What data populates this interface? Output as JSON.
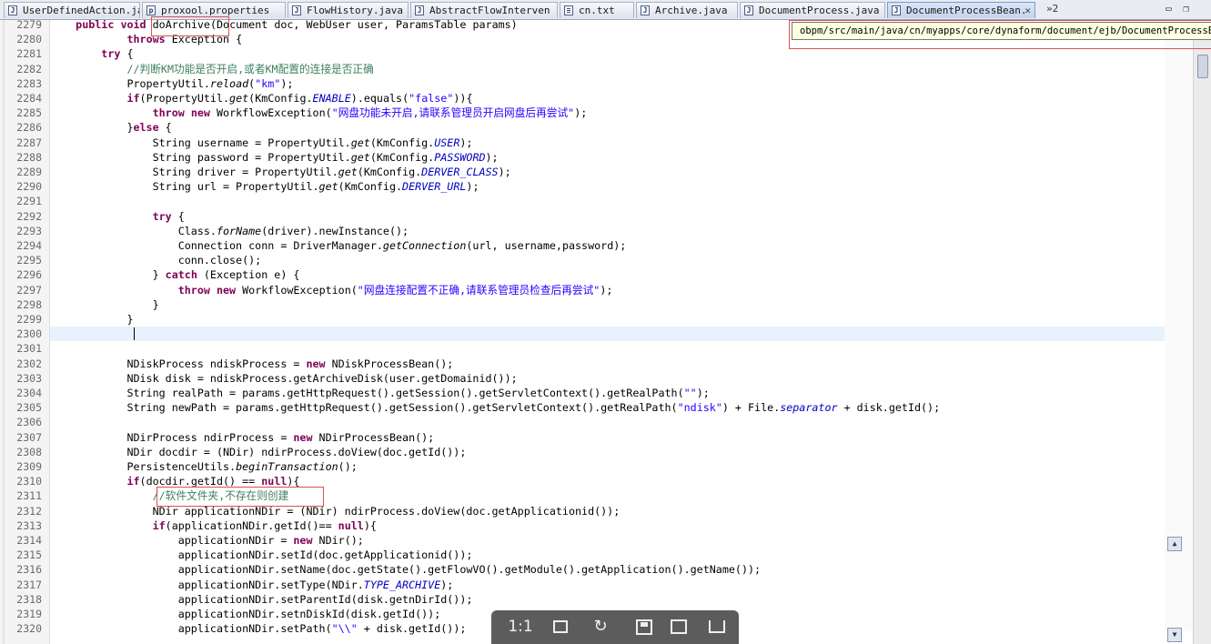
{
  "tabs": [
    {
      "label": "UserDefinedAction.ja",
      "active": false
    },
    {
      "label": "proxool.properties",
      "active": false
    },
    {
      "label": "FlowHistory.java",
      "active": false
    },
    {
      "label": "AbstractFlowInterven",
      "active": false
    },
    {
      "label": "cn.txt",
      "active": false
    },
    {
      "label": "Archive.java",
      "active": false
    },
    {
      "label": "DocumentProcess.java",
      "active": false
    },
    {
      "label": "DocumentProcessBean.",
      "active": true,
      "close": "✕"
    }
  ],
  "tab_overflow": "»2",
  "tooltip_path": "obpm/src/main/java/cn/myapps/core/dynaform/document/ejb/DocumentProcessBean.java",
  "line_numbers": [
    "2279",
    "2280",
    "2281",
    "2282",
    "2283",
    "2284",
    "2285",
    "2286",
    "2287",
    "2288",
    "2289",
    "2290",
    "2291",
    "2292",
    "2293",
    "2294",
    "2295",
    "2296",
    "2297",
    "2298",
    "2299",
    "2300",
    "2301",
    "2302",
    "2303",
    "2304",
    "2305",
    "2306",
    "2307",
    "2308",
    "2309",
    "2310",
    "2311",
    "2312",
    "2313",
    "2314",
    "2315",
    "2316",
    "2317",
    "2318",
    "2319",
    "2320"
  ],
  "code_lines": [
    "    public void doArchive(Document doc, WebUser user, ParamsTable params)",
    "            throws Exception {",
    "        try {",
    "            //判断KM功能是否开启,或者KM配置的连接是否正确",
    "            PropertyUtil.reload(\"km\");",
    "            if(PropertyUtil.get(KmConfig.ENABLE).equals(\"false\")){",
    "                throw new WorkflowException(\"网盘功能未开启,请联系管理员开启网盘后再尝试\");",
    "            }else {",
    "                String username = PropertyUtil.get(KmConfig.USER);",
    "                String password = PropertyUtil.get(KmConfig.PASSWORD);",
    "                String driver = PropertyUtil.get(KmConfig.DERVER_CLASS);",
    "                String url = PropertyUtil.get(KmConfig.DERVER_URL);",
    "",
    "                try {",
    "                    Class.forName(driver).newInstance();",
    "                    Connection conn = DriverManager.getConnection(url, username,password);",
    "                    conn.close();",
    "                } catch (Exception e) {",
    "                    throw new WorkflowException(\"网盘连接配置不正确,请联系管理员检查后再尝试\");",
    "                }",
    "            }",
    "",
    "",
    "            NDiskProcess ndiskProcess = new NDiskProcessBean();",
    "            NDisk disk = ndiskProcess.getArchiveDisk(user.getDomainid());",
    "            String realPath = params.getHttpRequest().getSession().getServletContext().getRealPath(\"\");",
    "            String newPath = params.getHttpRequest().getSession().getServletContext().getRealPath(\"ndisk\") + File.separator + disk.getId();",
    "",
    "            NDirProcess ndirProcess = new NDirProcessBean();",
    "            NDir docdir = (NDir) ndirProcess.doView(doc.getId());",
    "            PersistenceUtils.beginTransaction();",
    "            if(docdir.getId() == null){",
    "                //软件文件夹,不存在则创建",
    "                NDir applicationNDir = (NDir) ndirProcess.doView(doc.getApplicationid());",
    "                if(applicationNDir.getId()== null){",
    "                    applicationNDir = new NDir();",
    "                    applicationNDir.setId(doc.getApplicationid());",
    "                    applicationNDir.setName(doc.getState().getFlowVO().getModule().getApplication().getName());",
    "                    applicationNDir.setType(NDir.TYPE_ARCHIVE);",
    "                    applicationNDir.setParentId(disk.getnDirId());",
    "                    applicationNDir.setnDiskId(disk.getId());",
    "                    applicationNDir.setPath(\"\\\\\" + disk.getId());"
  ],
  "viewer_toolbar": {
    "ratio_label": "1:1",
    "fit_icon": "fit-screen-icon",
    "rotate_icon": "rotate-icon",
    "save_icon": "save-icon",
    "saveas_icon": "save-as-icon",
    "share_icon": "share-icon"
  },
  "colors": {
    "keyword": "#7f0055",
    "comment": "#3f7f5f",
    "string": "#2a00ff",
    "highlight_box": "#d9534f",
    "tooltip_bg": "#ffffe1"
  }
}
